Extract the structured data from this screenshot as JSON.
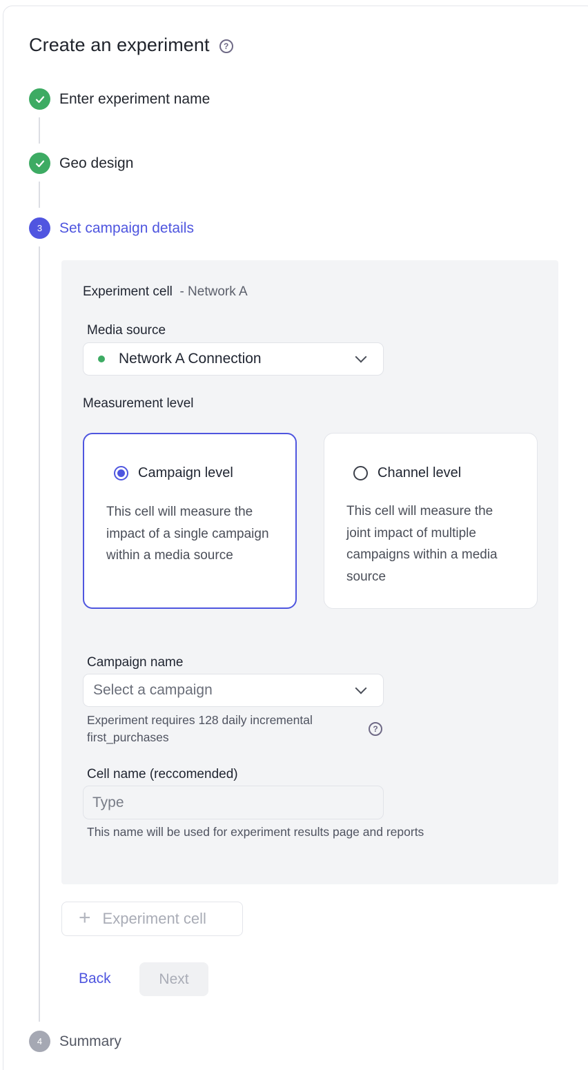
{
  "header": {
    "title": "Create an experiment",
    "help_icon": "?"
  },
  "steps": [
    {
      "label": "Enter experiment name",
      "status": "done",
      "icon": "check-icon"
    },
    {
      "label": "Geo design",
      "status": "done",
      "icon": "check-icon"
    },
    {
      "label": "Set campaign details",
      "status": "active",
      "number": "3"
    },
    {
      "label": "Summary",
      "status": "pending",
      "number": "4"
    }
  ],
  "cell": {
    "title": "Experiment cell",
    "subtitle": "- Network A",
    "media_source": {
      "label": "Media source",
      "value": "Network A Connection",
      "status_color": "#3dab63"
    },
    "measurement": {
      "label": "Measurement level",
      "options": [
        {
          "label": "Campaign level",
          "description": "This cell will measure the impact of a single campaign within a media source",
          "selected": true
        },
        {
          "label": "Channel level",
          "description": "This cell will measure the joint impact of multiple campaigns within a media source",
          "selected": false
        }
      ]
    },
    "campaign": {
      "label": "Campaign name",
      "placeholder": "Select a campaign",
      "hint": "Experiment requires 128 daily incremental first_purchases",
      "help_icon": "?"
    },
    "cell_name": {
      "label": "Cell name (reccomended)",
      "placeholder": "Type",
      "value": "",
      "hint": "This name will be used for experiment results page and reports"
    }
  },
  "actions": {
    "add_cell_icon": "+",
    "add_cell_label": "Experiment cell",
    "back_label": "Back",
    "next_label": "Next"
  },
  "colors": {
    "accent": "#4e55df",
    "success": "#3dab63",
    "pending": "#a5a8b3"
  }
}
